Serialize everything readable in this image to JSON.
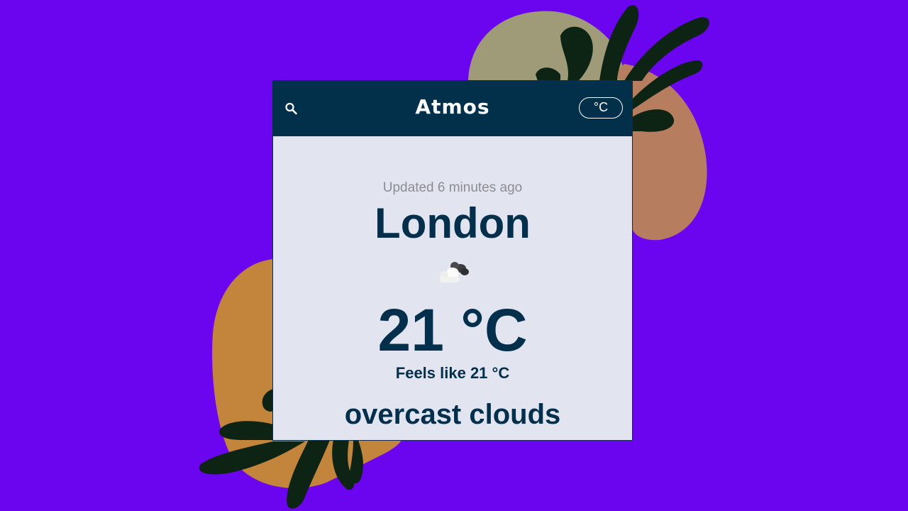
{
  "app": {
    "title": "Atmos"
  },
  "header": {
    "search_icon": "search-icon",
    "unit_toggle_label": "°C"
  },
  "weather": {
    "updated": "Updated 6 minutes ago",
    "city": "London",
    "condition_icon": "overcast-clouds-icon",
    "temperature": "21 °C",
    "feels_like": "Feels like 21 °C",
    "description": "overcast clouds"
  },
  "colors": {
    "background": "#6b05ef",
    "header": "#02304a",
    "card": "#e2e5f0",
    "text": "#022f4b"
  }
}
